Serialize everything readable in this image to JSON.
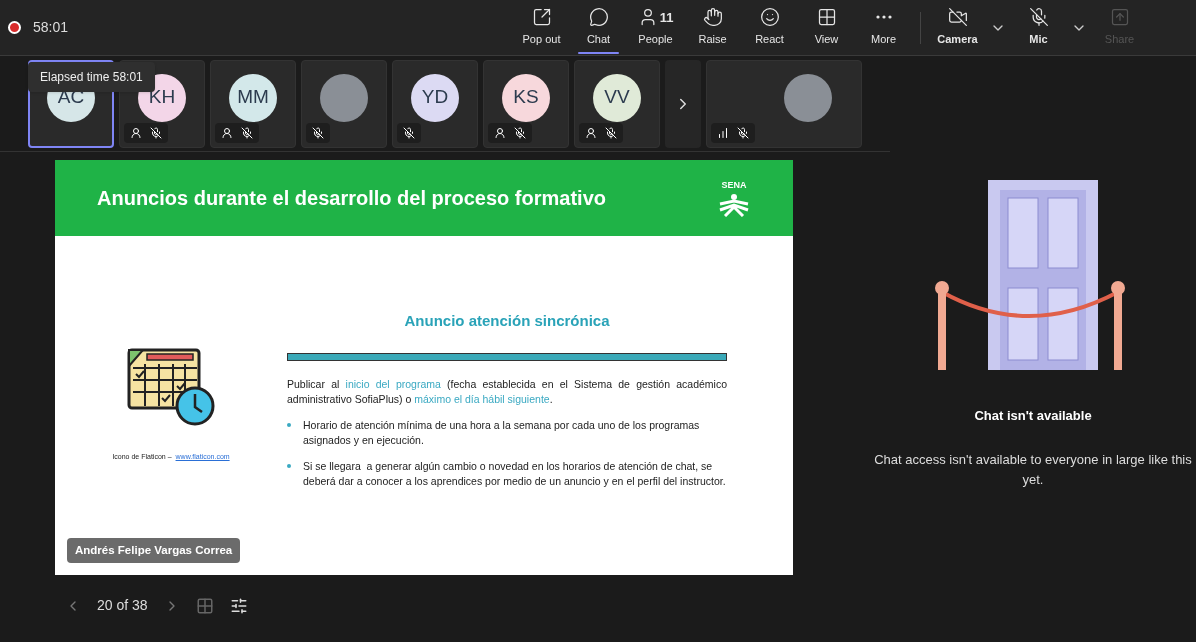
{
  "recording": {
    "on": true,
    "time": "58:01"
  },
  "toolbar": [
    {
      "kind": "popout",
      "label": "Pop out",
      "selected": false,
      "disabled": false
    },
    {
      "kind": "chat",
      "label": "Chat",
      "selected": true,
      "disabled": false
    },
    {
      "kind": "people",
      "label": "People",
      "count": "11",
      "selected": false,
      "disabled": false
    },
    {
      "kind": "raise",
      "label": "Raise",
      "selected": false,
      "disabled": false
    },
    {
      "kind": "react",
      "label": "React",
      "selected": false,
      "disabled": false
    },
    {
      "kind": "view",
      "label": "View",
      "selected": false,
      "disabled": false
    },
    {
      "kind": "more",
      "label": "More",
      "selected": false,
      "disabled": false
    },
    {
      "kind": "camera",
      "label": "Camera",
      "selected": false,
      "disabled": false
    },
    {
      "kind": "mic",
      "label": "Mic",
      "selected": false,
      "disabled": false
    },
    {
      "kind": "share",
      "label": "Share",
      "selected": false,
      "disabled": true
    }
  ],
  "tooltip": "Elapsed time 58:01",
  "participants": [
    {
      "kind": "initials",
      "initials": "AC",
      "color": "#d6e6e8",
      "selected": true,
      "status_icon": false,
      "muted": false,
      "signal": false
    },
    {
      "kind": "initials",
      "initials": "KH",
      "color": "#f3d6e8",
      "selected": false,
      "status_icon": true,
      "muted": true,
      "signal": false
    },
    {
      "kind": "initials",
      "initials": "MM",
      "color": "#d3e8ea",
      "selected": false,
      "status_icon": true,
      "muted": true,
      "signal": false
    },
    {
      "kind": "photo",
      "selected": false,
      "status_icon": false,
      "muted": true,
      "signal": false
    },
    {
      "kind": "initials",
      "initials": "YD",
      "color": "#dcdaf3",
      "selected": false,
      "status_icon": false,
      "muted": true,
      "signal": false
    },
    {
      "kind": "initials",
      "initials": "KS",
      "color": "#f7d8dc",
      "selected": false,
      "status_icon": true,
      "muted": true,
      "signal": false
    },
    {
      "kind": "initials",
      "initials": "VV",
      "color": "#e0ead8",
      "selected": false,
      "status_icon": true,
      "muted": true,
      "signal": false
    },
    {
      "kind": "more"
    },
    {
      "kind": "photo",
      "wide": true,
      "selected": false,
      "status_icon": false,
      "muted": true,
      "signal": true
    }
  ],
  "slide": {
    "title": "Anuncios durante el desarrollo del proceso formativo",
    "logo": "SENA",
    "subtitle": "Anuncio atención sincrónica",
    "intro": [
      {
        "text": "Publicar al ",
        "highlight": false
      },
      {
        "text": "inicio del programa",
        "highlight": true
      },
      {
        "text": " (fecha establecida en el Sistema de gestión académico administrativo SofiaPlus) o ",
        "highlight": false
      },
      {
        "text": "máximo el día hábil siguiente",
        "highlight": true
      },
      {
        "text": ".",
        "highlight": false
      }
    ],
    "bullets": [
      "Horario de atención mínima de una hora a la semana por cada uno de los programas asignados y en ejecución.",
      "Si se llegara  a generar algún cambio o novedad en los horarios de atención de chat, se deberá dar a conocer a los aprendices por medio de un anuncio y en el perfil del instructor."
    ],
    "caption": "Icono de Flaticon –",
    "caption_link": "www.flaticon.com",
    "presenter": "Andrés Felipe Vargas Correa"
  },
  "slide_nav": "20 of 38",
  "chat_panel": {
    "title": "Chat isn't available",
    "message": "Chat access isn't available to everyone in large like this yet."
  }
}
